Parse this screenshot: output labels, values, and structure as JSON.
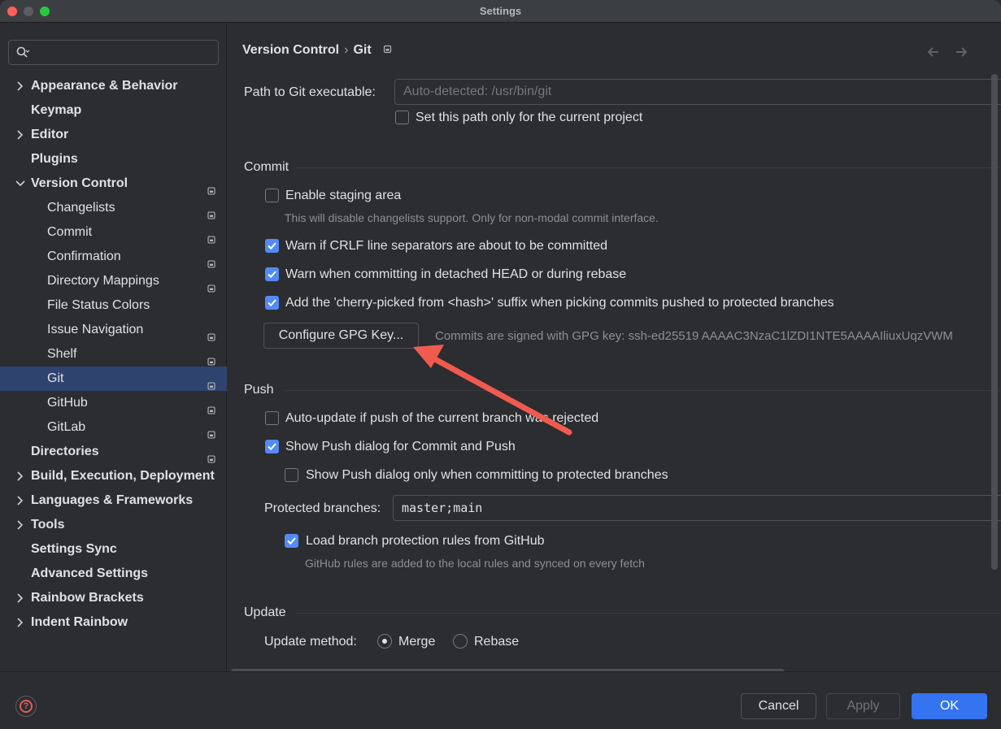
{
  "window": {
    "title": "Settings"
  },
  "sidebar": {
    "search_placeholder": "",
    "items": [
      {
        "label": "Appearance & Behavior",
        "expandable": true,
        "expanded": false,
        "level": 0,
        "project_icon": false
      },
      {
        "label": "Keymap",
        "expandable": false,
        "level": 0,
        "project_icon": false
      },
      {
        "label": "Editor",
        "expandable": true,
        "expanded": false,
        "level": 0,
        "project_icon": false
      },
      {
        "label": "Plugins",
        "expandable": false,
        "level": 0,
        "project_icon": false
      },
      {
        "label": "Version Control",
        "expandable": true,
        "expanded": true,
        "level": 0,
        "project_icon": true
      },
      {
        "label": "Changelists",
        "level": 1,
        "project_icon": true
      },
      {
        "label": "Commit",
        "level": 1,
        "project_icon": true
      },
      {
        "label": "Confirmation",
        "level": 1,
        "project_icon": true
      },
      {
        "label": "Directory Mappings",
        "level": 1,
        "project_icon": true
      },
      {
        "label": "File Status Colors",
        "level": 1,
        "project_icon": false
      },
      {
        "label": "Issue Navigation",
        "level": 1,
        "project_icon": true
      },
      {
        "label": "Shelf",
        "level": 1,
        "project_icon": true
      },
      {
        "label": "Git",
        "level": 1,
        "project_icon": true,
        "selected": true
      },
      {
        "label": "GitHub",
        "level": 1,
        "project_icon": true
      },
      {
        "label": "GitLab",
        "level": 1,
        "project_icon": true
      },
      {
        "label": "Directories",
        "expandable": false,
        "level": 0,
        "project_icon": true
      },
      {
        "label": "Build, Execution, Deployment",
        "expandable": true,
        "expanded": false,
        "level": 0,
        "project_icon": false
      },
      {
        "label": "Languages & Frameworks",
        "expandable": true,
        "expanded": false,
        "level": 0,
        "project_icon": false
      },
      {
        "label": "Tools",
        "expandable": true,
        "expanded": false,
        "level": 0,
        "project_icon": false
      },
      {
        "label": "Settings Sync",
        "expandable": false,
        "level": 0,
        "project_icon": false
      },
      {
        "label": "Advanced Settings",
        "expandable": false,
        "level": 0,
        "project_icon": false
      },
      {
        "label": "Rainbow Brackets",
        "expandable": true,
        "expanded": false,
        "level": 0,
        "project_icon": false
      },
      {
        "label": "Indent Rainbow",
        "expandable": true,
        "expanded": false,
        "level": 0,
        "project_icon": false
      }
    ]
  },
  "breadcrumb": {
    "parent": "Version Control",
    "separator": "›",
    "current": "Git"
  },
  "git_path": {
    "label": "Path to Git executable:",
    "placeholder": "Auto-detected: /usr/bin/git",
    "current_project_only": {
      "label": "Set this path only for the current project",
      "checked": false
    }
  },
  "commit": {
    "title": "Commit",
    "enable_staging": {
      "label": "Enable staging area",
      "checked": false
    },
    "enable_staging_hint": "This will disable changelists support. Only for non-modal commit interface.",
    "warn_crlf": {
      "label": "Warn if CRLF line separators are about to be committed",
      "checked": true
    },
    "warn_detached": {
      "label": "Warn when committing in detached HEAD or during rebase",
      "checked": true
    },
    "cherry_pick": {
      "label": "Add the 'cherry-picked from <hash>' suffix when picking commits pushed to protected branches",
      "checked": true
    },
    "gpg_button": "Configure GPG Key...",
    "gpg_status": "Commits are signed with GPG key: ssh-ed25519 AAAAC3NzaC1lZDI1NTE5AAAAIliuxUqzVWM"
  },
  "push": {
    "title": "Push",
    "auto_update": {
      "label": "Auto-update if push of the current branch was rejected",
      "checked": false
    },
    "show_push_dialog": {
      "label": "Show Push dialog for Commit and Push",
      "checked": true
    },
    "show_push_protected": {
      "label": "Show Push dialog only when committing to protected branches",
      "checked": false
    },
    "protected_label": "Protected branches:",
    "protected_value": "master;main",
    "load_rules": {
      "label": "Load branch protection rules from GitHub",
      "checked": true
    },
    "load_rules_hint": "GitHub rules are added to the local rules and synced on every fetch"
  },
  "update": {
    "title": "Update",
    "method_label": "Update method:",
    "options": [
      {
        "label": "Merge",
        "selected": true
      },
      {
        "label": "Rebase",
        "selected": false
      }
    ]
  },
  "footer": {
    "cancel": "Cancel",
    "apply": "Apply",
    "ok": "OK"
  },
  "colors": {
    "accent": "#3574f0",
    "selection": "#2e436e",
    "annotation_arrow": "#f15b4f"
  }
}
